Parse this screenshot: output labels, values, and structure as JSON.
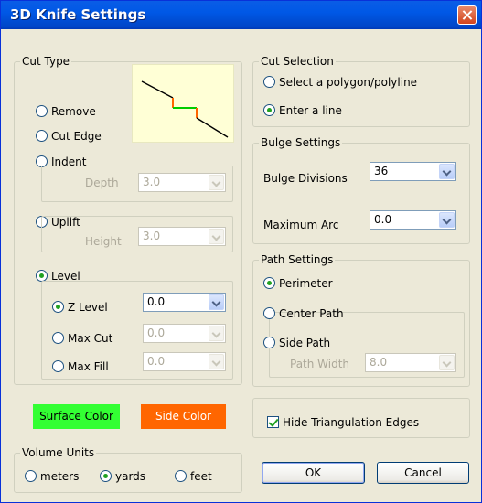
{
  "window": {
    "title": "3D Knife Settings"
  },
  "cut_type": {
    "legend": "Cut Type",
    "options": {
      "remove": "Remove",
      "cut_edge": "Cut Edge",
      "indent": "Indent",
      "uplift": "Uplift",
      "level": "Level"
    },
    "selected": "level",
    "depth": {
      "label": "Depth",
      "value": "3.0"
    },
    "height": {
      "label": "Height",
      "value": "3.0"
    },
    "level_options": {
      "z_level": "Z Level",
      "max_cut": "Max Cut",
      "max_fill": "Max Fill"
    },
    "level_selected": "z_level",
    "z_level_value": "0.0",
    "max_cut_value": "0.0",
    "max_fill_value": "0.0",
    "preview_colors": {
      "line": "#000000",
      "surface": "#00cc00",
      "side": "#ff6600"
    }
  },
  "colors": {
    "surface_label": "Surface Color",
    "surface_color": "#33ff33",
    "side_label": "Side Color",
    "side_color": "#ff6600"
  },
  "cut_selection": {
    "legend": "Cut Selection",
    "options": {
      "polygon": "Select a polygon/polyline",
      "line": "Enter a line"
    },
    "selected": "line"
  },
  "bulge": {
    "legend": "Bulge Settings",
    "divisions_label": "Bulge Divisions",
    "divisions_value": "36",
    "max_arc_label": "Maximum Arc",
    "max_arc_value": "0.0"
  },
  "path": {
    "legend": "Path Settings",
    "options": {
      "perimeter": "Perimeter",
      "center": "Center Path",
      "side": "Side Path"
    },
    "selected": "perimeter",
    "width_label": "Path Width",
    "width_value": "8.0"
  },
  "hide_edges": {
    "label": "Hide Triangulation Edges",
    "checked": true
  },
  "volume": {
    "legend": "Volume Units",
    "options": {
      "meters": "meters",
      "yards": "yards",
      "feet": "feet"
    },
    "selected": "yards"
  },
  "buttons": {
    "ok": "OK",
    "cancel": "Cancel"
  }
}
